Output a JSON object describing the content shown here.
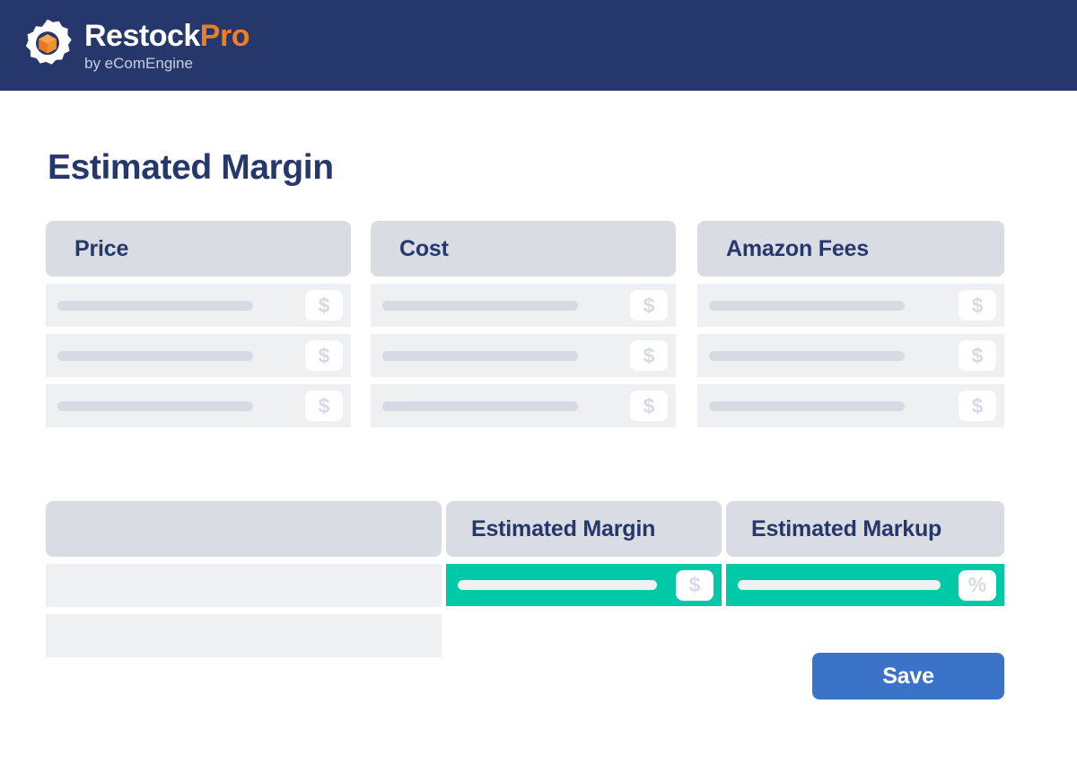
{
  "brand": {
    "logo_icon": "gear-cube-logo-icon",
    "name_primary": "Restock",
    "name_accent": "Pro",
    "tagline": "by eComEngine",
    "navy": "#26376B",
    "orange": "#EF7D22"
  },
  "page": {
    "title": "Estimated Margin"
  },
  "colors": {
    "header_gray": "#D9DCE3",
    "row_gray": "#EFF0F2",
    "placeholder_gray": "#D7DAE2",
    "accent_green": "#00C9A7",
    "save_blue": "#3B73C8",
    "navy_text": "#26376B"
  },
  "upper_columns": [
    {
      "id": "price",
      "header": "Price",
      "rows": [
        {
          "value": "",
          "unit": "$"
        },
        {
          "value": "",
          "unit": "$"
        },
        {
          "value": "",
          "unit": "$"
        }
      ]
    },
    {
      "id": "cost",
      "header": "Cost",
      "rows": [
        {
          "value": "",
          "unit": "$"
        },
        {
          "value": "",
          "unit": "$"
        },
        {
          "value": "",
          "unit": "$"
        }
      ]
    },
    {
      "id": "amazon-fees",
      "header": "Amazon Fees",
      "rows": [
        {
          "value": "",
          "unit": "$"
        },
        {
          "value": "",
          "unit": "$"
        },
        {
          "value": "",
          "unit": "$"
        }
      ]
    }
  ],
  "lower_columns": [
    {
      "id": "blank",
      "header": "",
      "rows": [
        {
          "value": "",
          "unit": ""
        },
        {
          "value": "",
          "unit": ""
        }
      ]
    },
    {
      "id": "estimated-margin",
      "header": "Estimated Margin",
      "rows": [
        {
          "value": "",
          "unit": "$"
        }
      ]
    },
    {
      "id": "estimated-markup",
      "header": "Estimated Markup",
      "rows": [
        {
          "value": "",
          "unit": "%"
        }
      ]
    }
  ],
  "actions": {
    "save_label": "Save"
  }
}
